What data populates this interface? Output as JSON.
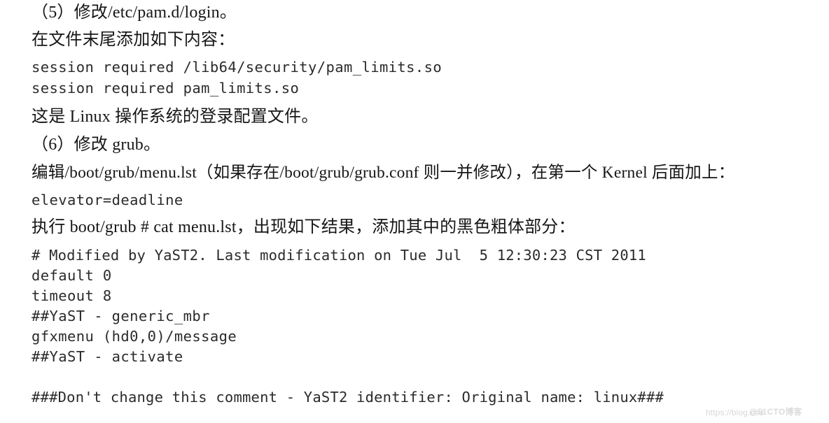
{
  "page": {
    "background_color": "#ffffff",
    "text_color": "#161616",
    "code_color": "#2b2b2b"
  },
  "content": {
    "lines": [
      {
        "id": "step5-heading",
        "text": "（5）修改/etc/pam.d/login。"
      },
      {
        "id": "step5-instruction",
        "text": "在文件末尾添加如下内容："
      },
      {
        "id": "pam-line-1",
        "text": "session required /lib64/security/pam_limits.so"
      },
      {
        "id": "pam-line-2",
        "text": "session required pam_limits.so"
      },
      {
        "id": "pam-note",
        "text": "这是 Linux 操作系统的登录配置文件。"
      },
      {
        "id": "step6-heading",
        "text": "（6）修改 grub。"
      },
      {
        "id": "grub-instruction",
        "text": "编辑/boot/grub/menu.lst（如果存在/boot/grub/grub.conf 则一并修改），在第一个 Kernel 后面加上："
      },
      {
        "id": "elevator-line",
        "text": "elevator=deadline"
      },
      {
        "id": "cat-instruction",
        "text": "执行 boot/grub # cat menu.lst，出现如下结果，添加其中的黑色粗体部分："
      },
      {
        "id": "menulst-line-1",
        "text": "# Modified by YaST2. Last modification on Tue Jul  5 12:30:23 CST 2011"
      },
      {
        "id": "menulst-line-2",
        "text": "default 0"
      },
      {
        "id": "menulst-line-3",
        "text": "timeout 8"
      },
      {
        "id": "menulst-line-4",
        "text": "##YaST - generic_mbr"
      },
      {
        "id": "menulst-line-5",
        "text": "gfxmenu (hd0,0)/message"
      },
      {
        "id": "menulst-line-6",
        "text": "##YaST - activate"
      },
      {
        "id": "menulst-line-7",
        "text": "###Don't change this comment - YaST2 identifier: Original name: linux###"
      }
    ]
  },
  "watermark": {
    "url_text": "https://blog.csd",
    "brand_text": "@51CTO博客"
  }
}
